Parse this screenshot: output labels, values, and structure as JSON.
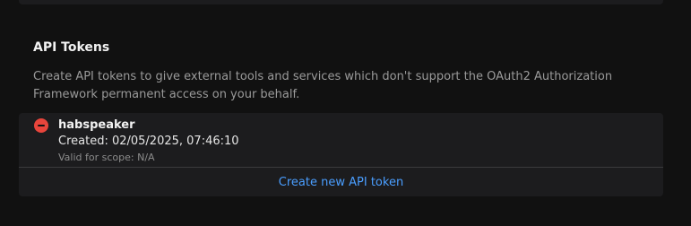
{
  "section": {
    "title": "API Tokens",
    "description": "Create API tokens to give external tools and services which don't support the OAuth2 Authorization Framework permanent access on your behalf."
  },
  "tokens": [
    {
      "name": "habspeaker",
      "created": "Created: 02/05/2025, 07:46:10",
      "scope": "Valid for scope: N/A",
      "remove_icon": "remove-circle-icon"
    }
  ],
  "actions": {
    "create_label": "Create new API token"
  },
  "colors": {
    "background": "#111111",
    "card": "#1c1c1e",
    "danger": "#e8453c",
    "link": "#4a9eff"
  }
}
